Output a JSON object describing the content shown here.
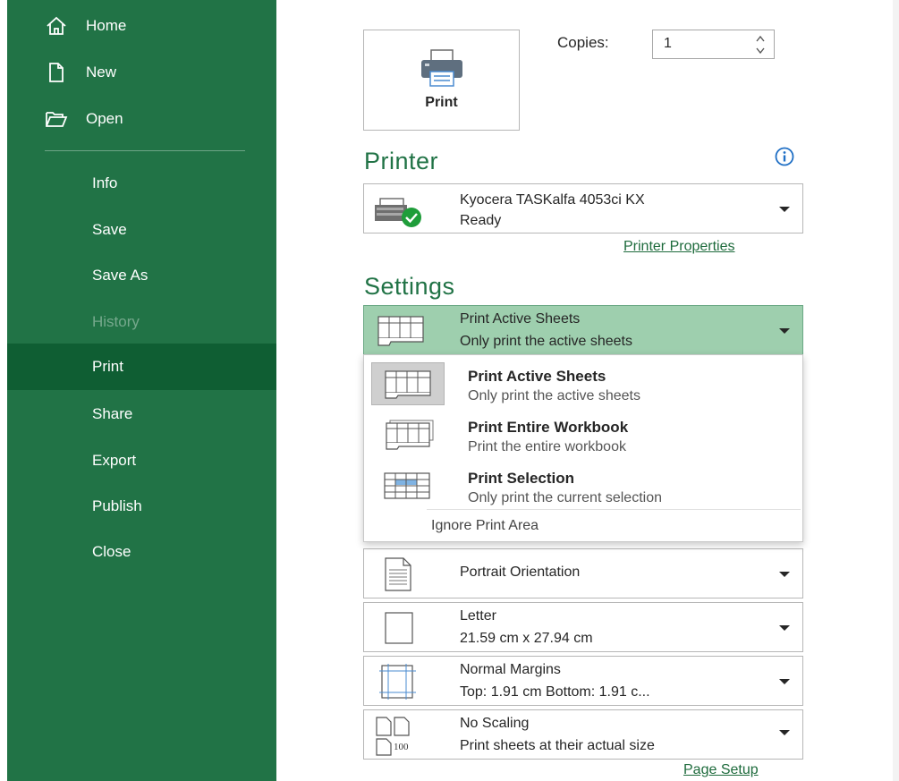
{
  "sidebar": {
    "top_items": [
      {
        "label": "Home",
        "icon": "home-icon"
      },
      {
        "label": "New",
        "icon": "new-document-icon"
      },
      {
        "label": "Open",
        "icon": "open-folder-icon"
      }
    ],
    "items": [
      {
        "label": "Info"
      },
      {
        "label": "Save"
      },
      {
        "label": "Save As"
      },
      {
        "label": "History",
        "disabled": true
      },
      {
        "label": "Print",
        "active": true
      },
      {
        "label": "Share"
      },
      {
        "label": "Export"
      },
      {
        "label": "Publish"
      },
      {
        "label": "Close"
      }
    ]
  },
  "print": {
    "button_label": "Print",
    "copies_label": "Copies:",
    "copies_value": "1"
  },
  "printer": {
    "section_title": "Printer",
    "name": "Kyocera TASKalfa 4053ci KX",
    "status": "Ready",
    "properties_link": "Printer Properties"
  },
  "settings": {
    "section_title": "Settings",
    "what_to_print": {
      "title": "Print Active Sheets",
      "subtitle": "Only print the active sheets"
    },
    "menu": {
      "options": [
        {
          "title": "Print Active Sheets",
          "subtitle": "Only print the active sheets"
        },
        {
          "title": "Print Entire Workbook",
          "subtitle": "Print the entire workbook"
        },
        {
          "title": "Print Selection",
          "subtitle": "Only print the current selection"
        }
      ],
      "ignore_print_area": "Ignore Print Area"
    },
    "orientation": {
      "title": "Portrait Orientation"
    },
    "paper": {
      "title": "Letter",
      "subtitle": "21.59 cm x 27.94 cm"
    },
    "margins": {
      "title": "Normal Margins",
      "subtitle": "Top: 1.91 cm Bottom: 1.91 c..."
    },
    "scaling": {
      "title": "No Scaling",
      "subtitle": "Print sheets at their actual size",
      "icon_text": "100"
    },
    "page_setup_link": "Page Setup"
  },
  "colors": {
    "sidebar_bg": "#217346",
    "sidebar_active": "#0f5e33",
    "accent_green": "#217346",
    "selected_dropdown": "#9ecfae",
    "ready_badge": "#1f9d3a",
    "info_blue": "#1f6fc5"
  }
}
